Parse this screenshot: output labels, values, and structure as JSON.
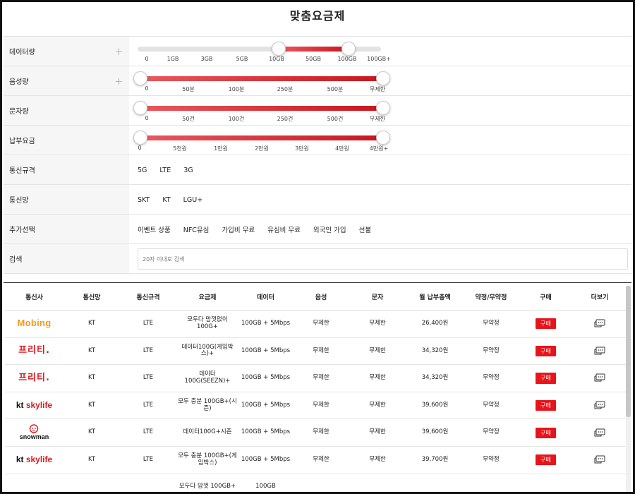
{
  "page": {
    "title": "맞춤요금제"
  },
  "filters": {
    "data": {
      "label": "데이터량",
      "ticks": [
        "0",
        "1GB",
        "3GB",
        "5GB",
        "10GB",
        "50GB",
        "100GB",
        "100GB+"
      ],
      "selected_range": [
        "10GB",
        "100GB"
      ]
    },
    "voice": {
      "label": "음성량",
      "ticks": [
        "0",
        "50분",
        "100분",
        "250분",
        "500분",
        "무제한"
      ],
      "selected_range": [
        "0",
        "무제한"
      ]
    },
    "sms": {
      "label": "문자량",
      "ticks": [
        "0",
        "50건",
        "100건",
        "250건",
        "500건",
        "무제한"
      ],
      "selected_range": [
        "0",
        "무제한"
      ]
    },
    "fee": {
      "label": "납부요금",
      "ticks": [
        "0",
        "5천원",
        "1만원",
        "2만원",
        "3만원",
        "4만원",
        "4만원+"
      ],
      "selected_range": [
        "0",
        "4만원+"
      ]
    },
    "standard": {
      "label": "통신규격",
      "options": [
        "5G",
        "LTE",
        "3G"
      ]
    },
    "network": {
      "label": "통신망",
      "options": [
        "SKT",
        "KT",
        "LGU+"
      ]
    },
    "extra": {
      "label": "추가선택",
      "options": [
        "이벤트 상품",
        "NFC유심",
        "가입비 무료",
        "유심비 무료",
        "외국인 가입",
        "선불"
      ]
    },
    "search": {
      "label": "검색",
      "placeholder": "20자 이내로 검색"
    }
  },
  "table": {
    "headers": [
      "통신사",
      "통신망",
      "통신규격",
      "요금제",
      "데이터",
      "음성",
      "문자",
      "월 납부총액",
      "약정/무약정",
      "구매",
      "더보기"
    ],
    "buy_label": "구매",
    "rows": [
      {
        "carrier": "Mobing",
        "logo": "mobing",
        "network": "KT",
        "standard": "LTE",
        "plan": "모두다 맘껏없이 100G+",
        "data": "100GB + 5Mbps",
        "voice": "무제한",
        "sms": "무제한",
        "price": "26,400원",
        "contract": "무약정"
      },
      {
        "carrier": "프리티",
        "logo": "freet",
        "network": "KT",
        "standard": "LTE",
        "plan": "데이터100G(게임박스)+",
        "data": "100GB + 5Mbps",
        "voice": "무제한",
        "sms": "무제한",
        "price": "34,320원",
        "contract": "무약정"
      },
      {
        "carrier": "프리티",
        "logo": "freet",
        "network": "KT",
        "standard": "LTE",
        "plan": "데이터100G(SEEZN)+",
        "data": "100GB + 5Mbps",
        "voice": "무제한",
        "sms": "무제한",
        "price": "34,320원",
        "contract": "무약정"
      },
      {
        "carrier": "kt skylife",
        "logo": "kt",
        "network": "KT",
        "standard": "LTE",
        "plan": "모두 충분 100GB+(시즌)",
        "data": "100GB + 5Mbps",
        "voice": "무제한",
        "sms": "무제한",
        "price": "39,600원",
        "contract": "무약정"
      },
      {
        "carrier": "snowman",
        "logo": "snowman",
        "network": "KT",
        "standard": "LTE",
        "plan": "데이터100G+시즌",
        "data": "100GB + 5Mbps",
        "voice": "무제한",
        "sms": "무제한",
        "price": "39,600원",
        "contract": "무약정"
      },
      {
        "carrier": "kt skylife",
        "logo": "kt",
        "network": "KT",
        "standard": "LTE",
        "plan": "모두 충분 100GB+(게임박스)",
        "data": "100GB + 5Mbps",
        "voice": "무제한",
        "sms": "무제한",
        "price": "39,700원",
        "contract": "무약정"
      },
      {
        "carrier": "",
        "logo": "none",
        "network": "",
        "standard": "",
        "plan": "모두다 맘껏 100GB+",
        "data": "100GB",
        "voice": "",
        "sms": "",
        "price": "",
        "contract": ""
      }
    ]
  },
  "colors": {
    "accent": "#e8141c",
    "slider_track": "#e3e3e3",
    "label_bg": "#f6f6f6"
  },
  "icons": {
    "expand": "plus-icon",
    "more": "chat-bubble-icon"
  }
}
